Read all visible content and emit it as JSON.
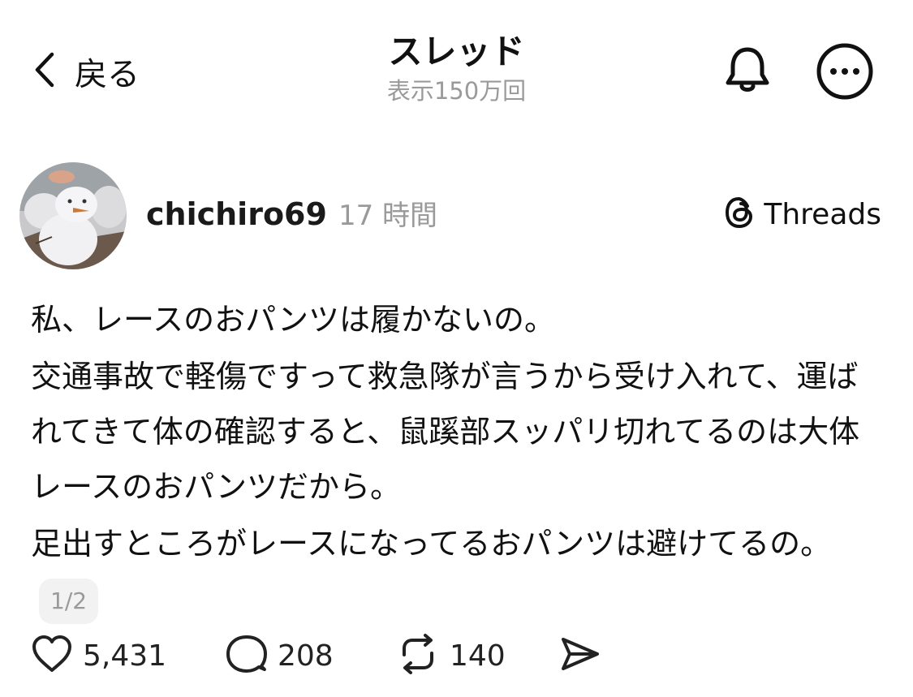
{
  "header": {
    "back_label": "戻る",
    "title": "スレッド",
    "view_count": "表示150万回"
  },
  "post": {
    "username": "chichiro69",
    "timestamp": "17 時間",
    "source_label": "Threads",
    "paragraphs": [
      "私、レースのおパンツは履かないの。",
      "交通事故で軽傷ですって救急隊が言うから受け入れて、運ばれてきて体の確認すると、鼠蹊部スッパリ切れてるのは大体レースのおパンツだから。",
      "足出すところがレースになってるおパンツは避けてるの。"
    ],
    "page_indicator": "1/2"
  },
  "actions": {
    "likes": "5,431",
    "replies": "208",
    "reposts": "140"
  },
  "icons": {
    "back": "chevron-left-icon",
    "notifications": "bell-icon",
    "more": "more-icon",
    "threads": "threads-logo-icon",
    "like": "heart-icon",
    "reply": "comment-icon",
    "repost": "repost-icon",
    "share": "send-icon"
  }
}
